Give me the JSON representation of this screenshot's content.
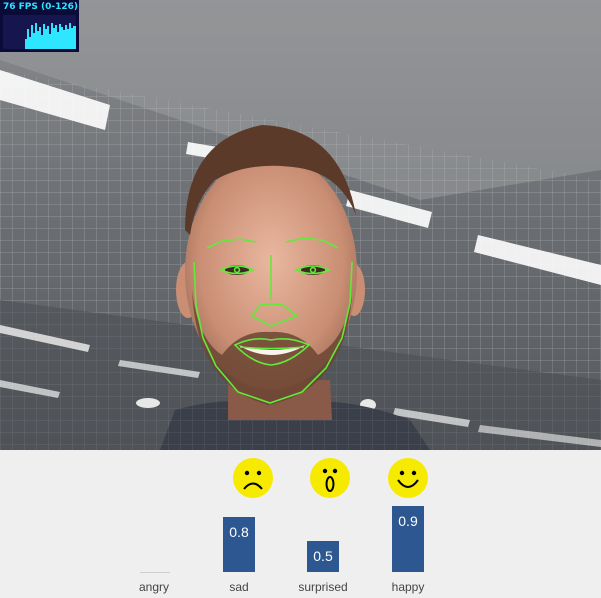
{
  "fps": {
    "text": "76 FPS (0-126)"
  },
  "emotions": [
    {
      "label": "angry",
      "value": "",
      "score": 0.0,
      "icon": "none"
    },
    {
      "label": "sad",
      "value": "0.8",
      "score": 0.8,
      "icon": "sad-face-icon"
    },
    {
      "label": "surprised",
      "value": "0.5",
      "score": 0.5,
      "icon": "surprised-face-icon"
    },
    {
      "label": "happy",
      "value": "0.9",
      "score": 0.9,
      "icon": "happy-face-icon"
    }
  ],
  "colors": {
    "bar": "#2d5791",
    "emoji": "#f6ea00",
    "face_mesh": "#62ea3a",
    "fps_text": "#2ee6ff",
    "fps_bg": "#0b0b3a"
  }
}
